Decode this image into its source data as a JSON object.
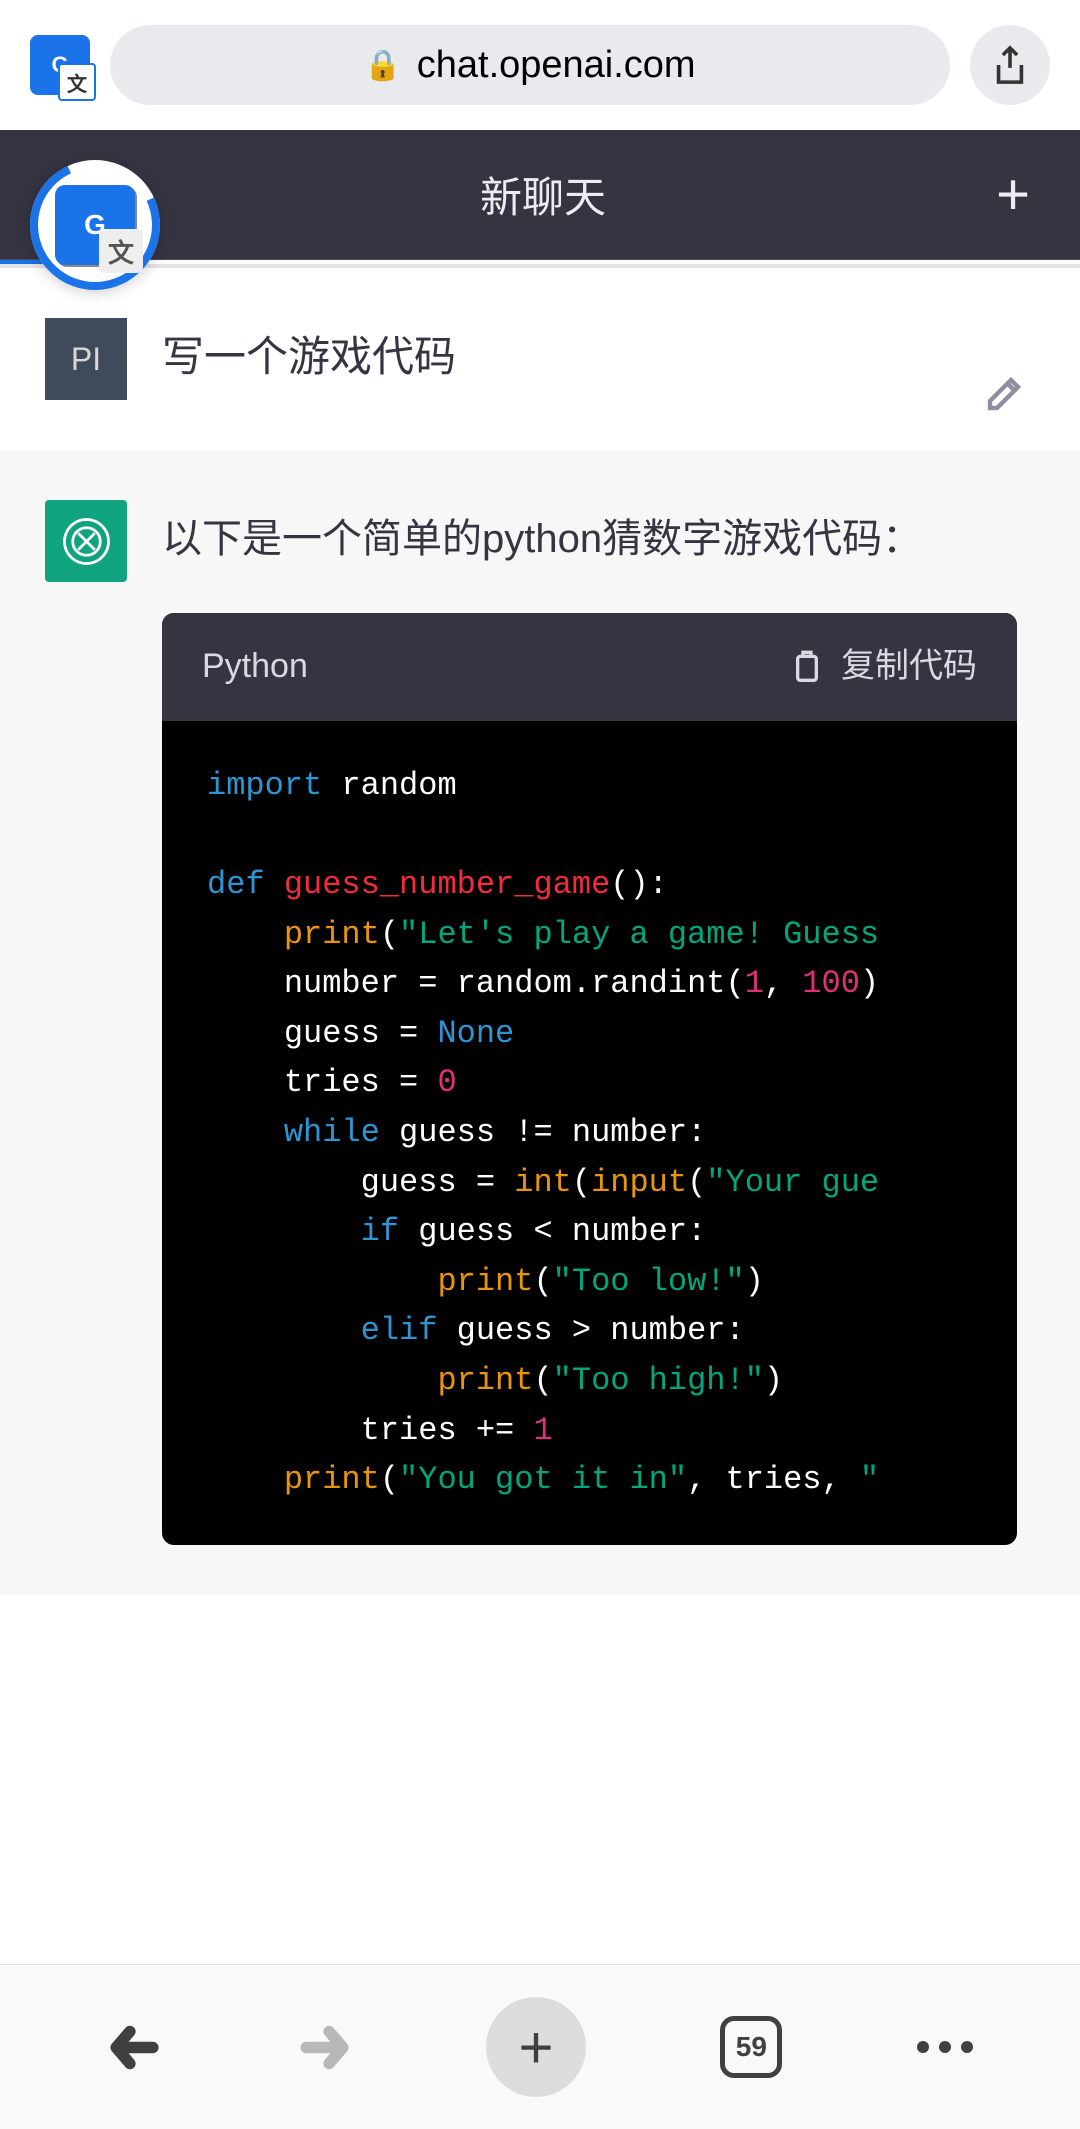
{
  "browser": {
    "url": "chat.openai.com",
    "tab_count": "59"
  },
  "header": {
    "title": "新聊天"
  },
  "user_message": {
    "avatar_initials": "PI",
    "text": "写一个游戏代码"
  },
  "bot_message": {
    "intro": "以下是一个简单的python猜数字游戏代码：",
    "code_lang": "Python",
    "copy_label": "复制代码",
    "code": {
      "l1_import": "import",
      "l1_mod": " random",
      "l3_def": "def",
      "l3_fn": " guess_number_game",
      "l3_paren": "():",
      "l4_pre": "    ",
      "l4_call": "print",
      "l4_open": "(",
      "l4_str": "\"Let's play a game! Guess",
      "l5_line": "    number = random.randint(",
      "l5_n1": "1",
      "l5_comma": ", ",
      "l5_n2": "100",
      "l5_close": ")",
      "l6_line": "    guess = ",
      "l6_none": "None",
      "l7_line": "    tries = ",
      "l7_num": "0",
      "l8_pre": "    ",
      "l8_kw": "while",
      "l8_rest": " guess != number:",
      "l9_line": "        guess = ",
      "l9_int": "int",
      "l9_open": "(",
      "l9_input": "input",
      "l9_open2": "(",
      "l9_str": "\"Your gue",
      "l10_pre": "        ",
      "l10_kw": "if",
      "l10_rest": " guess < number:",
      "l11_pre": "            ",
      "l11_call": "print",
      "l11_open": "(",
      "l11_str": "\"Too low!\"",
      "l11_close": ")",
      "l12_pre": "        ",
      "l12_kw": "elif",
      "l12_rest": " guess > number:",
      "l13_pre": "            ",
      "l13_call": "print",
      "l13_open": "(",
      "l13_str": "\"Too high!\"",
      "l13_close": ")",
      "l14_line": "        tries += ",
      "l14_num": "1",
      "l15_pre": "    ",
      "l15_call": "print",
      "l15_open": "(",
      "l15_str": "\"You got it in\"",
      "l15_rest": ", tries, ",
      "l15_trail": "\""
    }
  }
}
